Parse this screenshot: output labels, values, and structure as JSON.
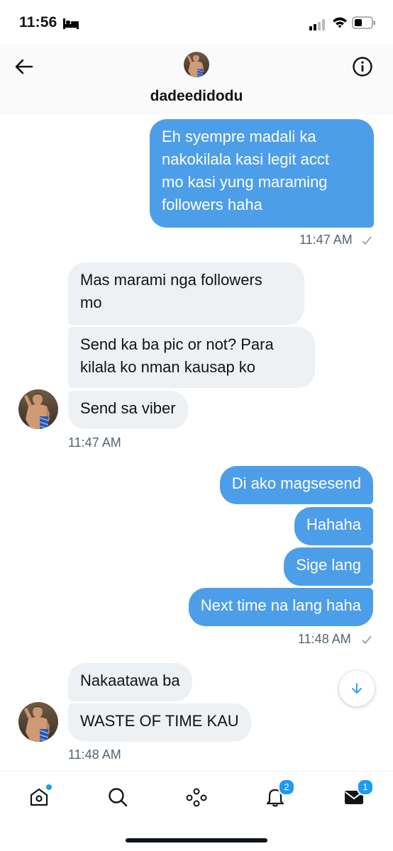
{
  "status_bar": {
    "time": "11:56"
  },
  "header": {
    "username": "dadeedidodu"
  },
  "messages": {
    "m1": {
      "lines": [
        "Eh syempre madali ka",
        "nakokilala kasi legit acct",
        "mo kasi yung maraming",
        "followers haha"
      ]
    },
    "ts1": "11:47 AM",
    "m2": {
      "lines": [
        "Mas marami nga followers",
        "mo"
      ]
    },
    "m3": {
      "lines": [
        "Send ka ba pic or not? Para",
        "kilala ko nman kausap ko"
      ]
    },
    "m4": "Send sa viber",
    "ts2": "11:47 AM",
    "m5": "Di ako magsesend",
    "m6": "Hahaha",
    "m7": "Sige lang",
    "m8": "Next time na lang haha",
    "ts3": "11:48 AM",
    "m9": "Nakaatawa ba",
    "m10": "WASTE OF TIME KAU",
    "ts4": "11:48 AM"
  },
  "nav": {
    "notifications_badge": "2",
    "messages_badge": "1"
  },
  "colors": {
    "outgoing_bubble": "#4d9ee9",
    "incoming_bubble": "#eef1f3",
    "accent": "#1d9bf0",
    "timestamp": "#536471"
  },
  "icons": [
    "back-arrow-icon",
    "info-icon",
    "home-icon",
    "search-icon",
    "spaces-icon",
    "bell-icon",
    "mail-icon",
    "arrow-down-icon",
    "bed-icon",
    "signal-icon",
    "wifi-icon",
    "battery-icon",
    "check-icon"
  ]
}
